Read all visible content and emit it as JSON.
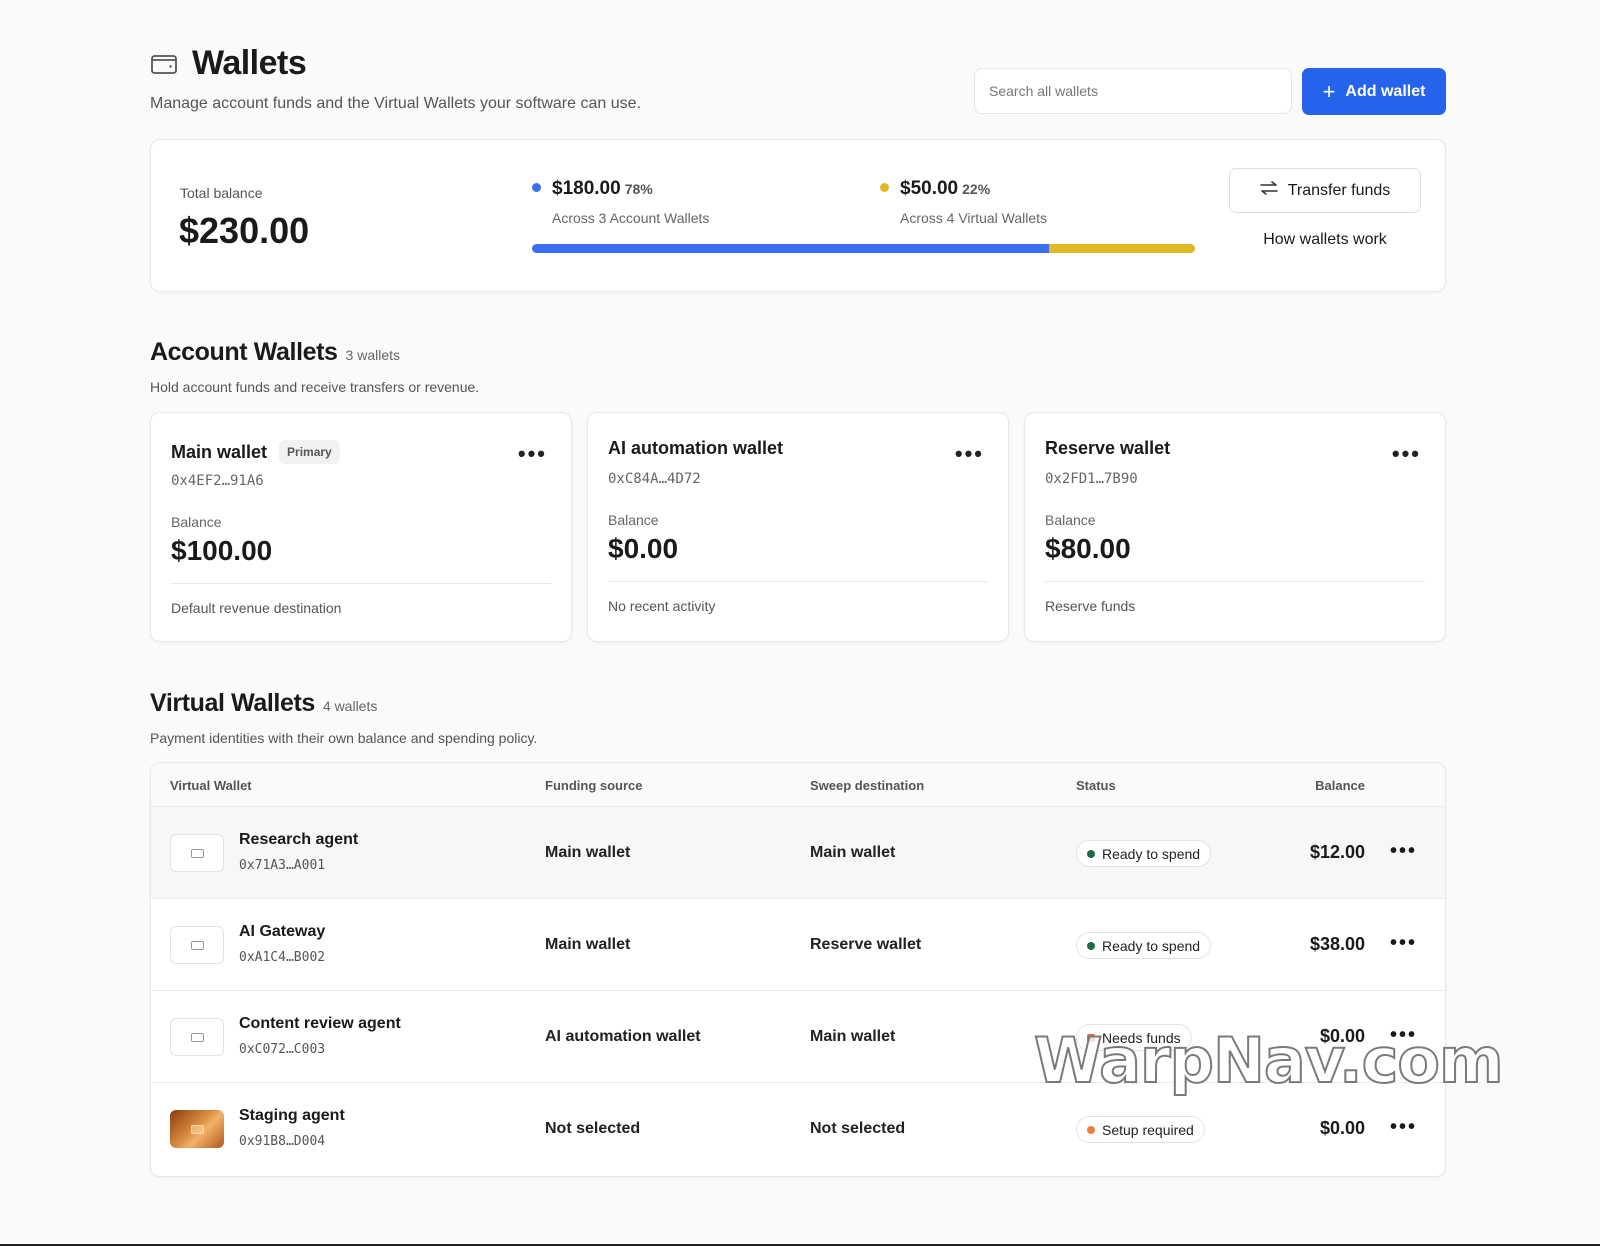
{
  "header": {
    "title": "Wallets",
    "subtitle": "Manage account funds and the Virtual Wallets your software can use.",
    "search_placeholder": "Search all wallets",
    "add_button_label": "Add wallet"
  },
  "balance": {
    "total_label": "Total balance",
    "total_value": "$230.00",
    "account_amount": "$180.00",
    "account_pct": "78%",
    "account_sub": "Across 3 Account Wallets",
    "virtual_amount": "$50.00",
    "virtual_pct": "22%",
    "virtual_sub": "Across 4 Virtual Wallets",
    "account_share": 0.78,
    "virtual_share": 0.22,
    "transfer_label": "Transfer funds",
    "how_label": "How wallets work"
  },
  "colors": {
    "accent": "#2563eb",
    "account_bar": "#3b6ef0",
    "virtual_bar": "#e0b923",
    "status_ready": "#1f6b4a",
    "status_needs": "#e06a3a",
    "status_setup": "#ef7d3a"
  },
  "account_section": {
    "title": "Account Wallets",
    "count": "3 wallets",
    "description": "Hold account funds and receive transfers or revenue.",
    "cards": [
      {
        "name": "Main wallet",
        "badge": "Primary",
        "address": "0x4EF2…91A6",
        "balance_label": "Balance",
        "balance": "$100.00",
        "note": "Default revenue destination"
      },
      {
        "name": "AI automation wallet",
        "badge": "",
        "address": "0xC84A…4D72",
        "balance_label": "Balance",
        "balance": "$0.00",
        "note": "No recent activity"
      },
      {
        "name": "Reserve wallet",
        "badge": "",
        "address": "0x2FD1…7B90",
        "balance_label": "Balance",
        "balance": "$80.00",
        "note": "Reserve funds"
      }
    ],
    "menu_glyph": "•••"
  },
  "virtual_section": {
    "title": "Virtual Wallets",
    "count": "4 wallets",
    "description": "Payment identities with their own balance and spending policy.",
    "columns": {
      "wallet": "Virtual Wallet",
      "funding": "Funding source",
      "sweep": "Sweep destination",
      "status": "Status",
      "balance": "Balance"
    },
    "rows": [
      {
        "name": "Research agent",
        "address": "0x71A3…A001",
        "funding": "Main wallet",
        "sweep": "Main wallet",
        "status": "Ready to spend",
        "balance": "$12.00",
        "icon": "card-icon"
      },
      {
        "name": "AI Gateway",
        "address": "0xA1C4…B002",
        "funding": "Main wallet",
        "sweep": "Reserve wallet",
        "status": "Ready to spend",
        "balance": "$38.00",
        "icon": "card-icon"
      },
      {
        "name": "Content review agent",
        "address": "0xC072…C003",
        "funding": "AI automation wallet",
        "sweep": "Main wallet",
        "status": "Needs funds",
        "balance": "$0.00",
        "icon": "card-icon"
      },
      {
        "name": "Staging agent",
        "address": "0x91B8…D004",
        "funding": "Not selected",
        "sweep": "Not selected",
        "status": "Setup required",
        "balance": "$0.00",
        "icon": "gold-card-icon"
      }
    ],
    "menu_glyph": "•••"
  },
  "watermark": "WarpNav.com"
}
